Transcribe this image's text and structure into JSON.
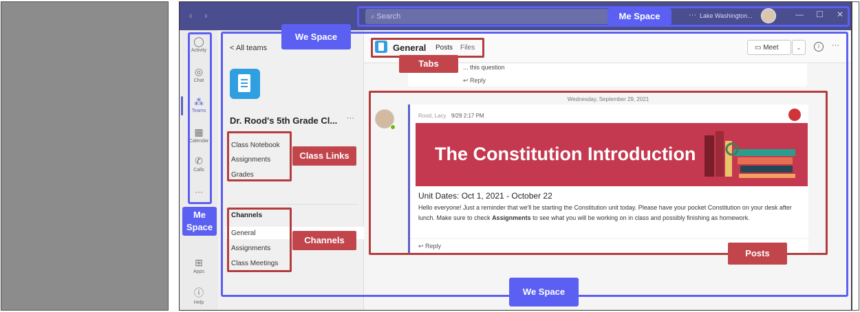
{
  "window": {
    "search_placeholder": "Search",
    "tenant": "Lake Washington...",
    "more": "···",
    "nav_back": "‹",
    "nav_forward": "›",
    "minimize": "—",
    "maximize": "☐",
    "close": "✕"
  },
  "rail": {
    "items": [
      {
        "label": "Activity",
        "icon": "bell-icon",
        "glyph": "🔔"
      },
      {
        "label": "Chat",
        "icon": "chat-icon",
        "glyph": "💬"
      },
      {
        "label": "Teams",
        "icon": "teams-icon",
        "glyph": "👥"
      },
      {
        "label": "Calendar",
        "icon": "calendar-icon",
        "glyph": "📅"
      },
      {
        "label": "Calls",
        "icon": "phone-icon",
        "glyph": "📞"
      }
    ],
    "more": "···",
    "apps": {
      "label": "Apps",
      "glyph": "⊞"
    },
    "help": {
      "label": "Help",
      "glyph": "?"
    },
    "active_color": "#5b5fc7"
  },
  "team": {
    "back": "< All teams",
    "name": "Dr. Rood's 5th Grade Cl...",
    "more": "···",
    "links": [
      "Class Notebook",
      "Assignments",
      "Grades"
    ],
    "channels_header": "Channels",
    "channels": [
      "General",
      "Assignments",
      "Class Meetings"
    ]
  },
  "channel": {
    "name": "General",
    "tabs": [
      "Posts",
      "Files"
    ],
    "meet": "Meet",
    "more": "···"
  },
  "posts": {
    "previous_text": "... this question",
    "reply": "Reply",
    "date_separator": "Wednesday, September 29, 2021",
    "author": "Rood, Lacy",
    "time": "9/29 2:17 PM",
    "banner_title": "The Constitution Introduction",
    "unit_dates": "Unit Dates: Oct 1, 2021 - October 22",
    "body_before": "Hello everyone! Just a reminder that we'll be starting the Constitution unit today. Please have your pocket Constitution on your desk after lunch. Make sure to check ",
    "body_bold": "Assignments",
    "body_after": " to see what you will be working on in class and possibly finishing as homework.",
    "banner_color": "#c4394f"
  },
  "annotations": {
    "me_space_top": "Me Space",
    "we_space_top": "We Space",
    "tabs": "Tabs",
    "class_links": "Class Links",
    "channels": "Channels",
    "me_space_side": "Me Space",
    "posts": "Posts",
    "we_space_bottom": "We Space",
    "blue": "#5b5ff2",
    "red": "#b23c3c"
  }
}
